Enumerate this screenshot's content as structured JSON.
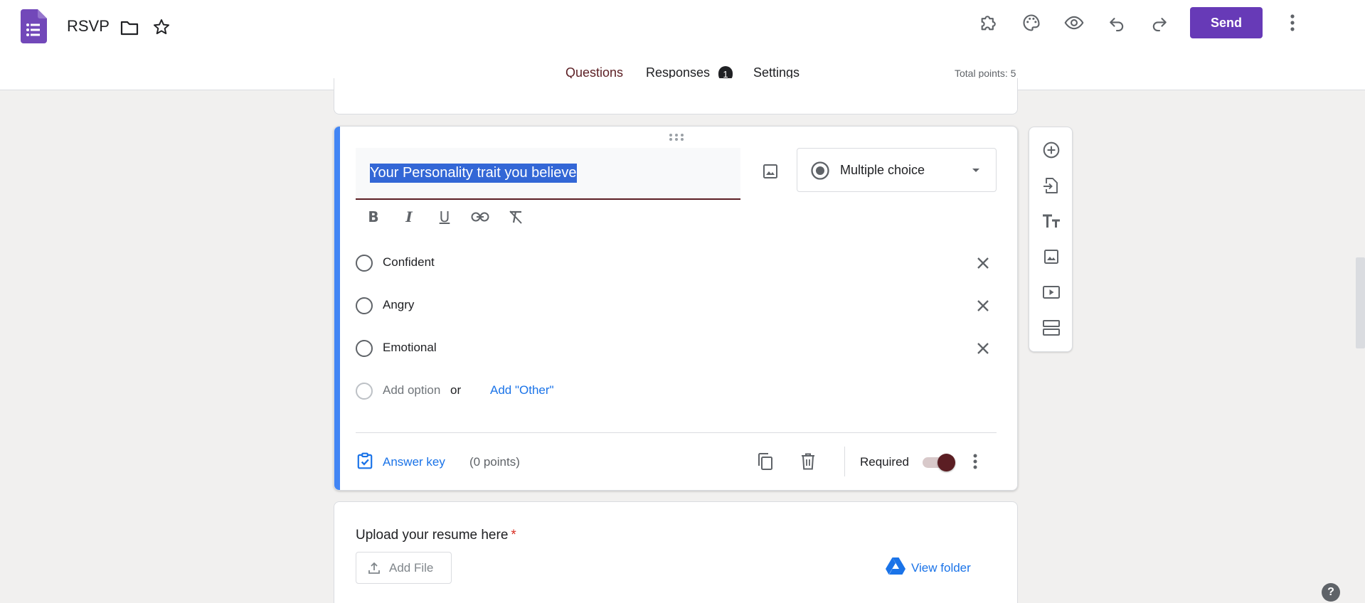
{
  "header": {
    "title": "RSVP",
    "send_label": "Send",
    "icons": [
      "forms-app-icon",
      "folder-icon",
      "star-icon",
      "addon-puzzle-icon",
      "palette-icon",
      "preview-eye-icon",
      "undo-icon",
      "redo-icon",
      "more-vert-icon"
    ]
  },
  "tabs": [
    {
      "label": "Questions",
      "active": true
    },
    {
      "label": "Responses",
      "badge": "1"
    },
    {
      "label": "Settings"
    }
  ],
  "total_points": "Total points: 5",
  "question": {
    "title": "Your Personality trait you believe",
    "type_label": "Multiple choice",
    "options": [
      {
        "label": "Confident"
      },
      {
        "label": "Angry"
      },
      {
        "label": "Emotional"
      }
    ],
    "add_option_label": "Add option",
    "or_label": "or",
    "add_other_label": "Add \"Other\"",
    "answer_key_label": "Answer key",
    "points_label": "(0 points)",
    "required_label": "Required",
    "required_on": true
  },
  "upload_question": {
    "title": "Upload your resume here",
    "required_mark": "*",
    "add_file_label": "Add File",
    "view_folder_label": "View folder"
  },
  "side_toolbar": [
    "add-question-icon",
    "import-questions-icon",
    "add-title-icon",
    "add-image-icon",
    "add-video-icon",
    "add-section-icon"
  ],
  "help_label": "?",
  "colors": {
    "accent_purple": "#673ab7",
    "active_tab": "#5b1e23",
    "question_accent": "#4285f4",
    "link_blue": "#1a73e8",
    "selection": "#3367d6"
  }
}
